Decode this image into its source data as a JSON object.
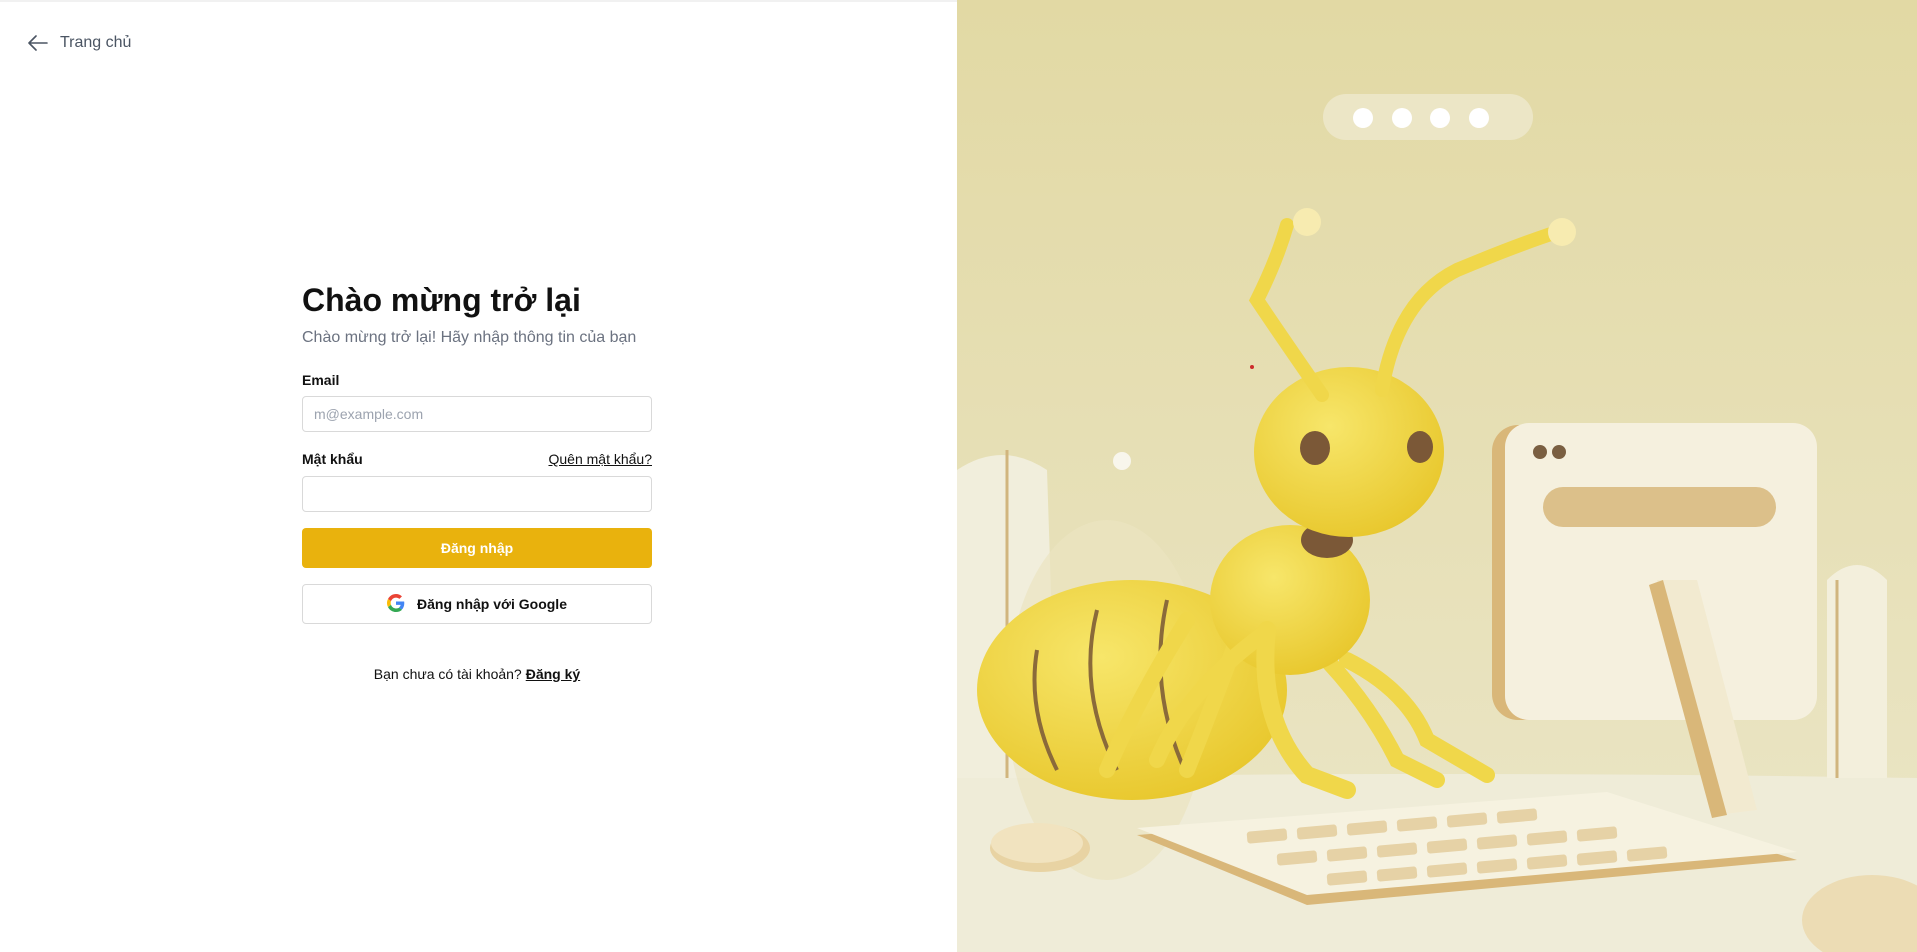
{
  "nav": {
    "back_label": "Trang chủ"
  },
  "login": {
    "title": "Chào mừng trở lại",
    "subtitle": "Chào mừng trở lại! Hãy nhập thông tin của bạn",
    "email_label": "Email",
    "email_placeholder": "m@example.com",
    "email_value": "",
    "password_label": "Mật khẩu",
    "password_value": "",
    "forgot_label": "Quên mật khẩu?",
    "submit_label": "Đăng nhập",
    "google_label": "Đăng nhập với Google",
    "no_account_text": "Bạn chưa có tài khoản?",
    "signup_label": "Đăng ký"
  },
  "colors": {
    "accent": "#e9b20d",
    "hero_background": "#e4dcb0",
    "ant_yellow": "#f2d640"
  },
  "icons": {
    "back": "arrow-left-icon",
    "google": "google-icon"
  },
  "illustration": {
    "subject": "ant-at-computer-illustration"
  }
}
